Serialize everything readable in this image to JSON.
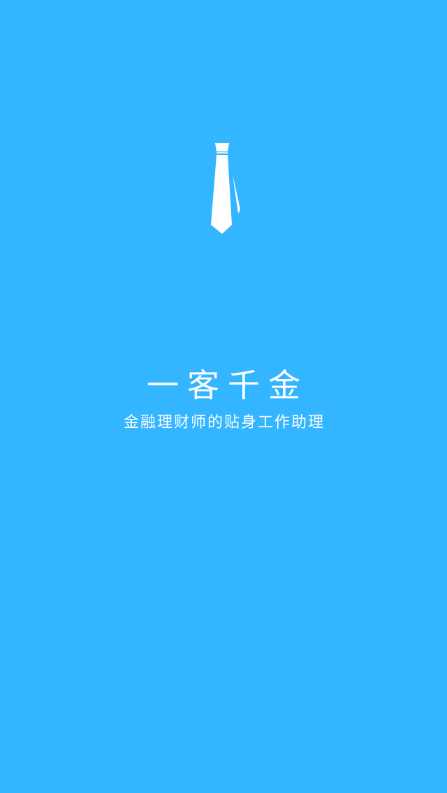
{
  "app": {
    "title": "一客千金",
    "tagline": "金融理财师的贴身工作助理"
  },
  "icons": {
    "logo": "necktie-icon"
  },
  "colors": {
    "background": "#33b5ff",
    "foreground": "#ffffff"
  }
}
